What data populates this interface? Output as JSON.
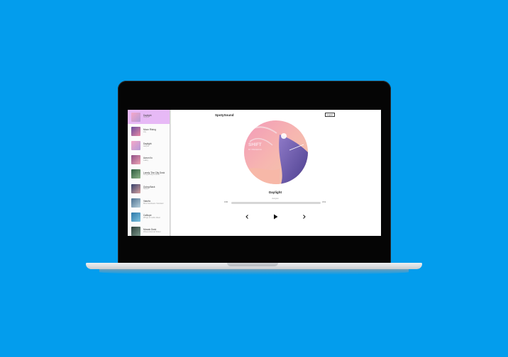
{
  "app": {
    "brand": "SpotySound",
    "logout_label": "Logout"
  },
  "tracks": [
    {
      "title": "Daylight",
      "artist": "Aaryan",
      "thumb": [
        "#f5a7c8",
        "#b59bd8"
      ],
      "active": true
    },
    {
      "title": "Moon Rising",
      "artist": "Lily",
      "thumb": [
        "#6b4e9e",
        "#e889a4"
      ],
      "active": false
    },
    {
      "title": "Daylight",
      "artist": "Aaryan",
      "thumb": [
        "#f5a7c8",
        "#b59bd8"
      ],
      "active": false
    },
    {
      "title": "Aaron Ilo",
      "artist": "Lakey",
      "thumb": [
        "#8e4e86",
        "#f0a6b5"
      ],
      "active": false
    },
    {
      "title": "Lonely The City Dusk",
      "artist": "Kongolo Ryoh Artist",
      "thumb": [
        "#2d5b3f",
        "#8fb58a"
      ],
      "active": false
    },
    {
      "title": "Going Back",
      "artist": "Nestor",
      "thumb": [
        "#33406a",
        "#d9a3a0"
      ],
      "active": false
    },
    {
      "title": "Valurfa",
      "artist": "Mira Kamikaze Yaroslavl",
      "thumb": [
        "#4b7090",
        "#b9d2de"
      ],
      "active": false
    },
    {
      "title": "Calliope",
      "artist": "Wings of Lahin Ideal",
      "thumb": [
        "#2c77a8",
        "#7ec3e0"
      ],
      "active": false
    },
    {
      "title": "Mosaic Dusk",
      "artist": "Waves Eternal Street",
      "thumb": [
        "#2b3e3a",
        "#7d9a8c"
      ],
      "active": false
    }
  ],
  "player": {
    "title": "Daylight",
    "artist": "Aaryan",
    "time_current": "0:00",
    "time_total": "3:19",
    "progress": 0.0,
    "cover_text_line1": "SHIFT",
    "cover_text_line2": "MY PRESENCE"
  },
  "controls": {
    "prev_icon": "chevron-left-icon",
    "play_icon": "play-icon",
    "next_icon": "chevron-right-icon"
  },
  "colors": {
    "background": "#039ded",
    "active_track": "#e7b9f6"
  }
}
